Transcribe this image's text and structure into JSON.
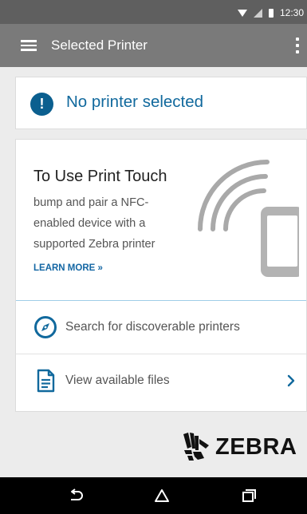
{
  "status_bar": {
    "time": "12:30"
  },
  "app_bar": {
    "title": "Selected Printer"
  },
  "printer_status": {
    "message": "No printer selected",
    "icon": "alert-icon"
  },
  "print_touch": {
    "title": "To Use Print Touch",
    "body": "bump and pair a NFC-enabled device with a supported Zebra printer",
    "learn_more": "LEARN MORE »"
  },
  "actions": {
    "search": {
      "label": "Search for discoverable printers",
      "icon": "compass-icon"
    },
    "files": {
      "label": "View available files",
      "icon": "document-icon"
    }
  },
  "brand": {
    "name": "ZEBRA"
  },
  "colors": {
    "accent": "#11699d",
    "app_bar": "#7a7a7a",
    "status_bar": "#5f5f5f",
    "background": "#ececec"
  }
}
